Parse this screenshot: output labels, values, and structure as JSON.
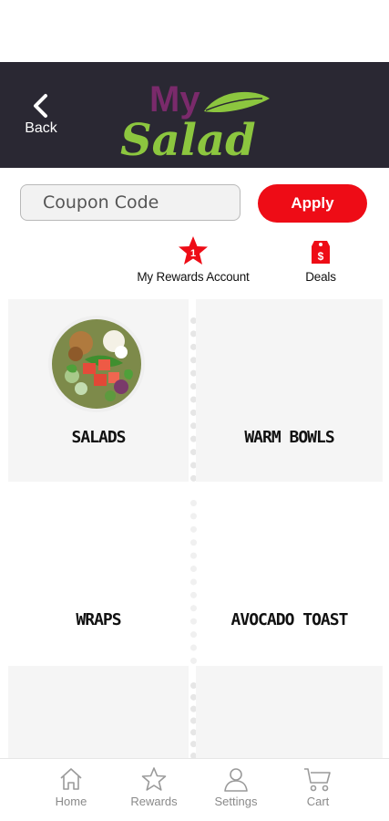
{
  "header": {
    "back_label": "Back",
    "logo_top": "My",
    "logo_bottom": "Salad"
  },
  "coupon": {
    "placeholder": "Coupon Code",
    "apply_label": "Apply"
  },
  "quick_links": {
    "rewards_label": "My Rewards Account",
    "rewards_badge": "1",
    "deals_label": "Deals",
    "deals_symbol": "$"
  },
  "categories": [
    {
      "label": "SALADS"
    },
    {
      "label": "WARM BOWLS"
    },
    {
      "label": "WRAPS"
    },
    {
      "label": "AVOCADO TOAST"
    }
  ],
  "bottom_nav": [
    {
      "label": "Home",
      "icon": "home-icon"
    },
    {
      "label": "Rewards",
      "icon": "star-icon"
    },
    {
      "label": "Settings",
      "icon": "person-icon"
    },
    {
      "label": "Cart",
      "icon": "cart-icon"
    }
  ],
  "colors": {
    "header_bg": "#2a2833",
    "accent_red": "#ee0c16",
    "logo_purple": "#7a2a6b",
    "logo_green": "#8cc63f"
  }
}
